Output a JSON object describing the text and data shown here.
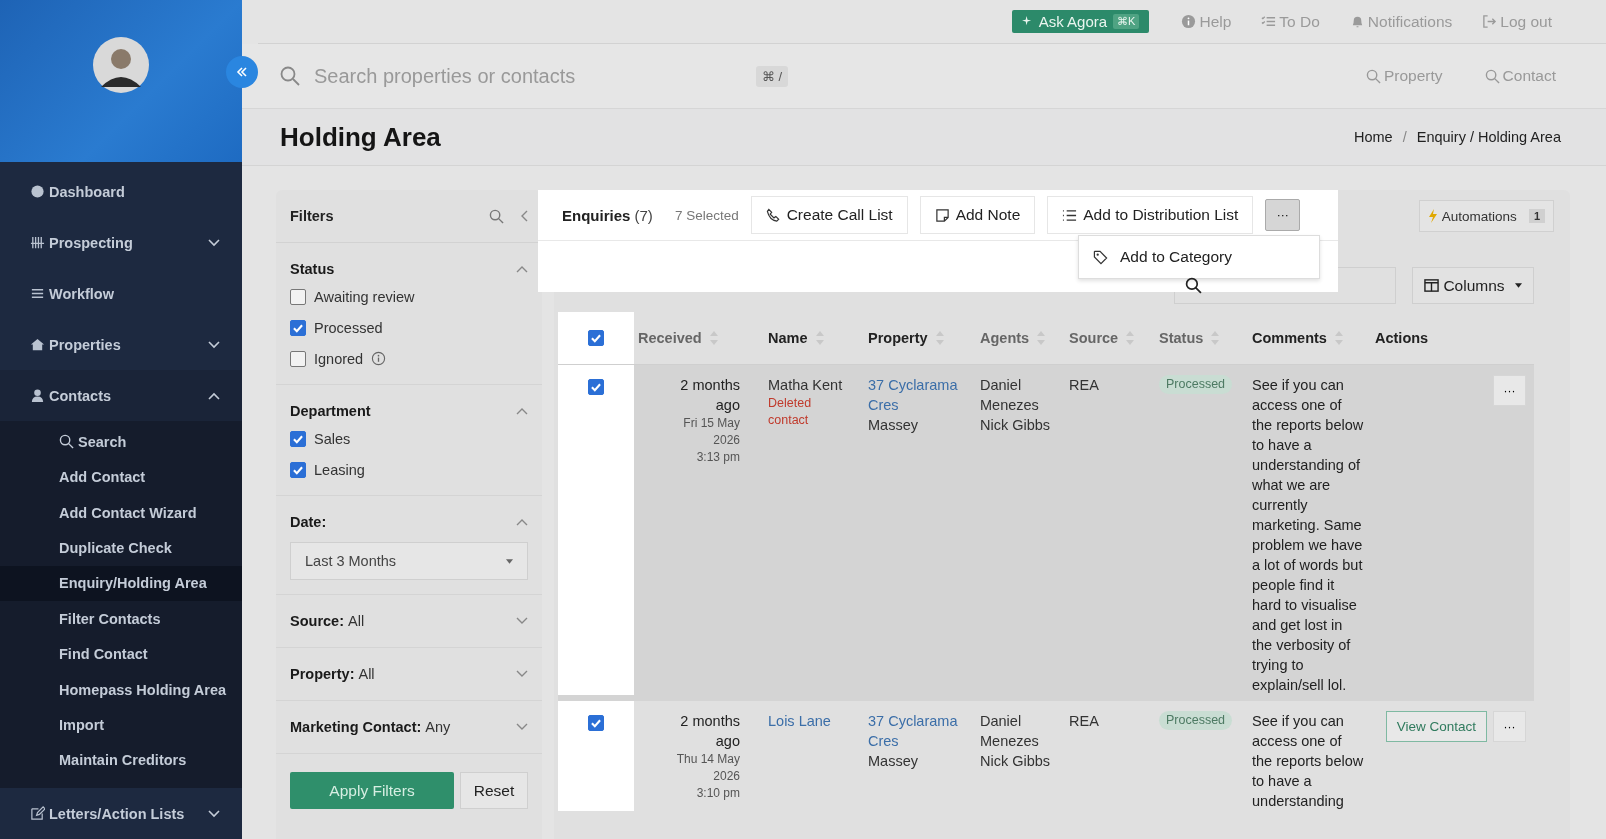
{
  "sidebar": {
    "items": [
      {
        "label": "Dashboard",
        "kind": "dashboard",
        "selected": false
      },
      {
        "label": "Prospecting",
        "kind": "tally",
        "selected": false,
        "expanded": false
      },
      {
        "label": "Workflow",
        "kind": "lines",
        "selected": false
      },
      {
        "label": "Properties",
        "kind": "home",
        "selected": false,
        "expanded": false
      },
      {
        "label": "Contacts",
        "kind": "person",
        "selected": false,
        "expanded": true,
        "children": [
          {
            "label": "Search",
            "kind": "search",
            "selected": false
          },
          {
            "label": "Add Contact",
            "selected": false
          },
          {
            "label": "Add Contact Wizard",
            "selected": false
          },
          {
            "label": "Duplicate Check",
            "selected": false
          },
          {
            "label": "Enquiry/Holding Area",
            "selected": true
          },
          {
            "label": "Filter Contacts",
            "selected": false
          },
          {
            "label": "Find Contact",
            "selected": false
          },
          {
            "label": "Homepass Holding Area",
            "selected": false
          },
          {
            "label": "Import",
            "selected": false
          },
          {
            "label": "Maintain Creditors",
            "selected": false
          }
        ]
      },
      {
        "label": "Letters/Action Lists",
        "kind": "edit",
        "selected": false,
        "expanded": false
      }
    ]
  },
  "top_bar": {
    "ask": {
      "label": "Ask Agora",
      "shortcut": "⌘K"
    },
    "links": [
      {
        "label": "Help",
        "kind": "info"
      },
      {
        "label": "To Do",
        "kind": "todo"
      },
      {
        "label": "Notifications",
        "kind": "bell"
      },
      {
        "label": "Log out",
        "kind": "logout"
      }
    ]
  },
  "search": {
    "placeholder": "Search properties or contacts",
    "shortcut": "⌘ /",
    "quick": [
      "Property",
      "Contact"
    ]
  },
  "page": {
    "title": "Holding Area",
    "breadcrumbs": [
      "Home",
      "Enquiry / Holding Area"
    ],
    "separator": "/"
  },
  "filters": {
    "title": "Filters",
    "sections": [
      {
        "kind": "checks",
        "title": "Status",
        "expanded": true,
        "options": [
          {
            "label": "Awaiting review",
            "checked": false
          },
          {
            "label": "Processed",
            "checked": true
          },
          {
            "label": "Ignored",
            "checked": false,
            "info": true
          }
        ]
      },
      {
        "kind": "checks",
        "title": "Department",
        "expanded": true,
        "options": [
          {
            "label": "Sales",
            "checked": true
          },
          {
            "label": "Leasing",
            "checked": true
          }
        ]
      },
      {
        "kind": "select",
        "title": "Date:",
        "expanded": true,
        "value": "Last 3 Months"
      },
      {
        "kind": "summary",
        "title": "Source:",
        "value": "All",
        "expanded": false
      },
      {
        "kind": "summary",
        "title": "Property:",
        "value": "All",
        "expanded": false
      },
      {
        "kind": "summary",
        "title": "Marketing Contact:",
        "value": "Any",
        "expanded": false
      }
    ],
    "apply": "Apply Filters",
    "reset": "Reset"
  },
  "toolbar": {
    "title": "Enquiries",
    "count": "(7)",
    "selected_count": "7 Selected",
    "buttons": [
      {
        "label": "Create Call List",
        "kind": "phone"
      },
      {
        "label": "Add Note",
        "kind": "note"
      },
      {
        "label": "Add to Distribution List",
        "kind": "list"
      }
    ],
    "more": "···",
    "menu": [
      {
        "label": "Add to Category",
        "kind": "tag"
      }
    ],
    "automations": {
      "label": "Automations",
      "count": "1"
    },
    "columns": "Columns"
  },
  "table": {
    "all_selected": true,
    "columns": [
      {
        "label": "Received",
        "sortable": true,
        "dim": true
      },
      {
        "label": "Name",
        "sortable": true
      },
      {
        "label": "Property",
        "sortable": true
      },
      {
        "label": "Agents",
        "sortable": true,
        "dim": true
      },
      {
        "label": "Source",
        "sortable": true,
        "dim": true
      },
      {
        "label": "Status",
        "sortable": true,
        "dim": true
      },
      {
        "label": "Comments",
        "sortable": true
      },
      {
        "label": "Actions",
        "sortable": false
      }
    ],
    "rows": [
      {
        "selected": true,
        "received": "2 months ago",
        "date": "Fri 15 May 2026",
        "time": "3:13 pm",
        "name": "Matha Kent",
        "name_link": false,
        "note": "Deleted contact",
        "street": "37 Cyclarama Cres",
        "suburb": "Massey",
        "agents": [
          "Daniel Menezes",
          "Nick Gibbs"
        ],
        "source": "REA",
        "status": "Processed",
        "comment": "See if you can access one of the reports below to have a understanding of what we are currently marketing. Same problem we have a lot of words but people find it hard to visualise and get lost in the verbosity of trying to explain/sell lol.",
        "more": "···"
      },
      {
        "selected": true,
        "received": "2 months ago",
        "date": "Thu 14 May 2026",
        "time": "3:10 pm",
        "name": "Lois Lane",
        "name_link": true,
        "street": "37 Cyclarama Cres",
        "suburb": "Massey",
        "agents": [
          "Daniel Menezes",
          "Nick Gibbs"
        ],
        "source": "REA",
        "status": "Processed",
        "comment": "See if you can access one of the reports below to have a understanding",
        "view": "View Contact",
        "more": "···"
      }
    ]
  }
}
